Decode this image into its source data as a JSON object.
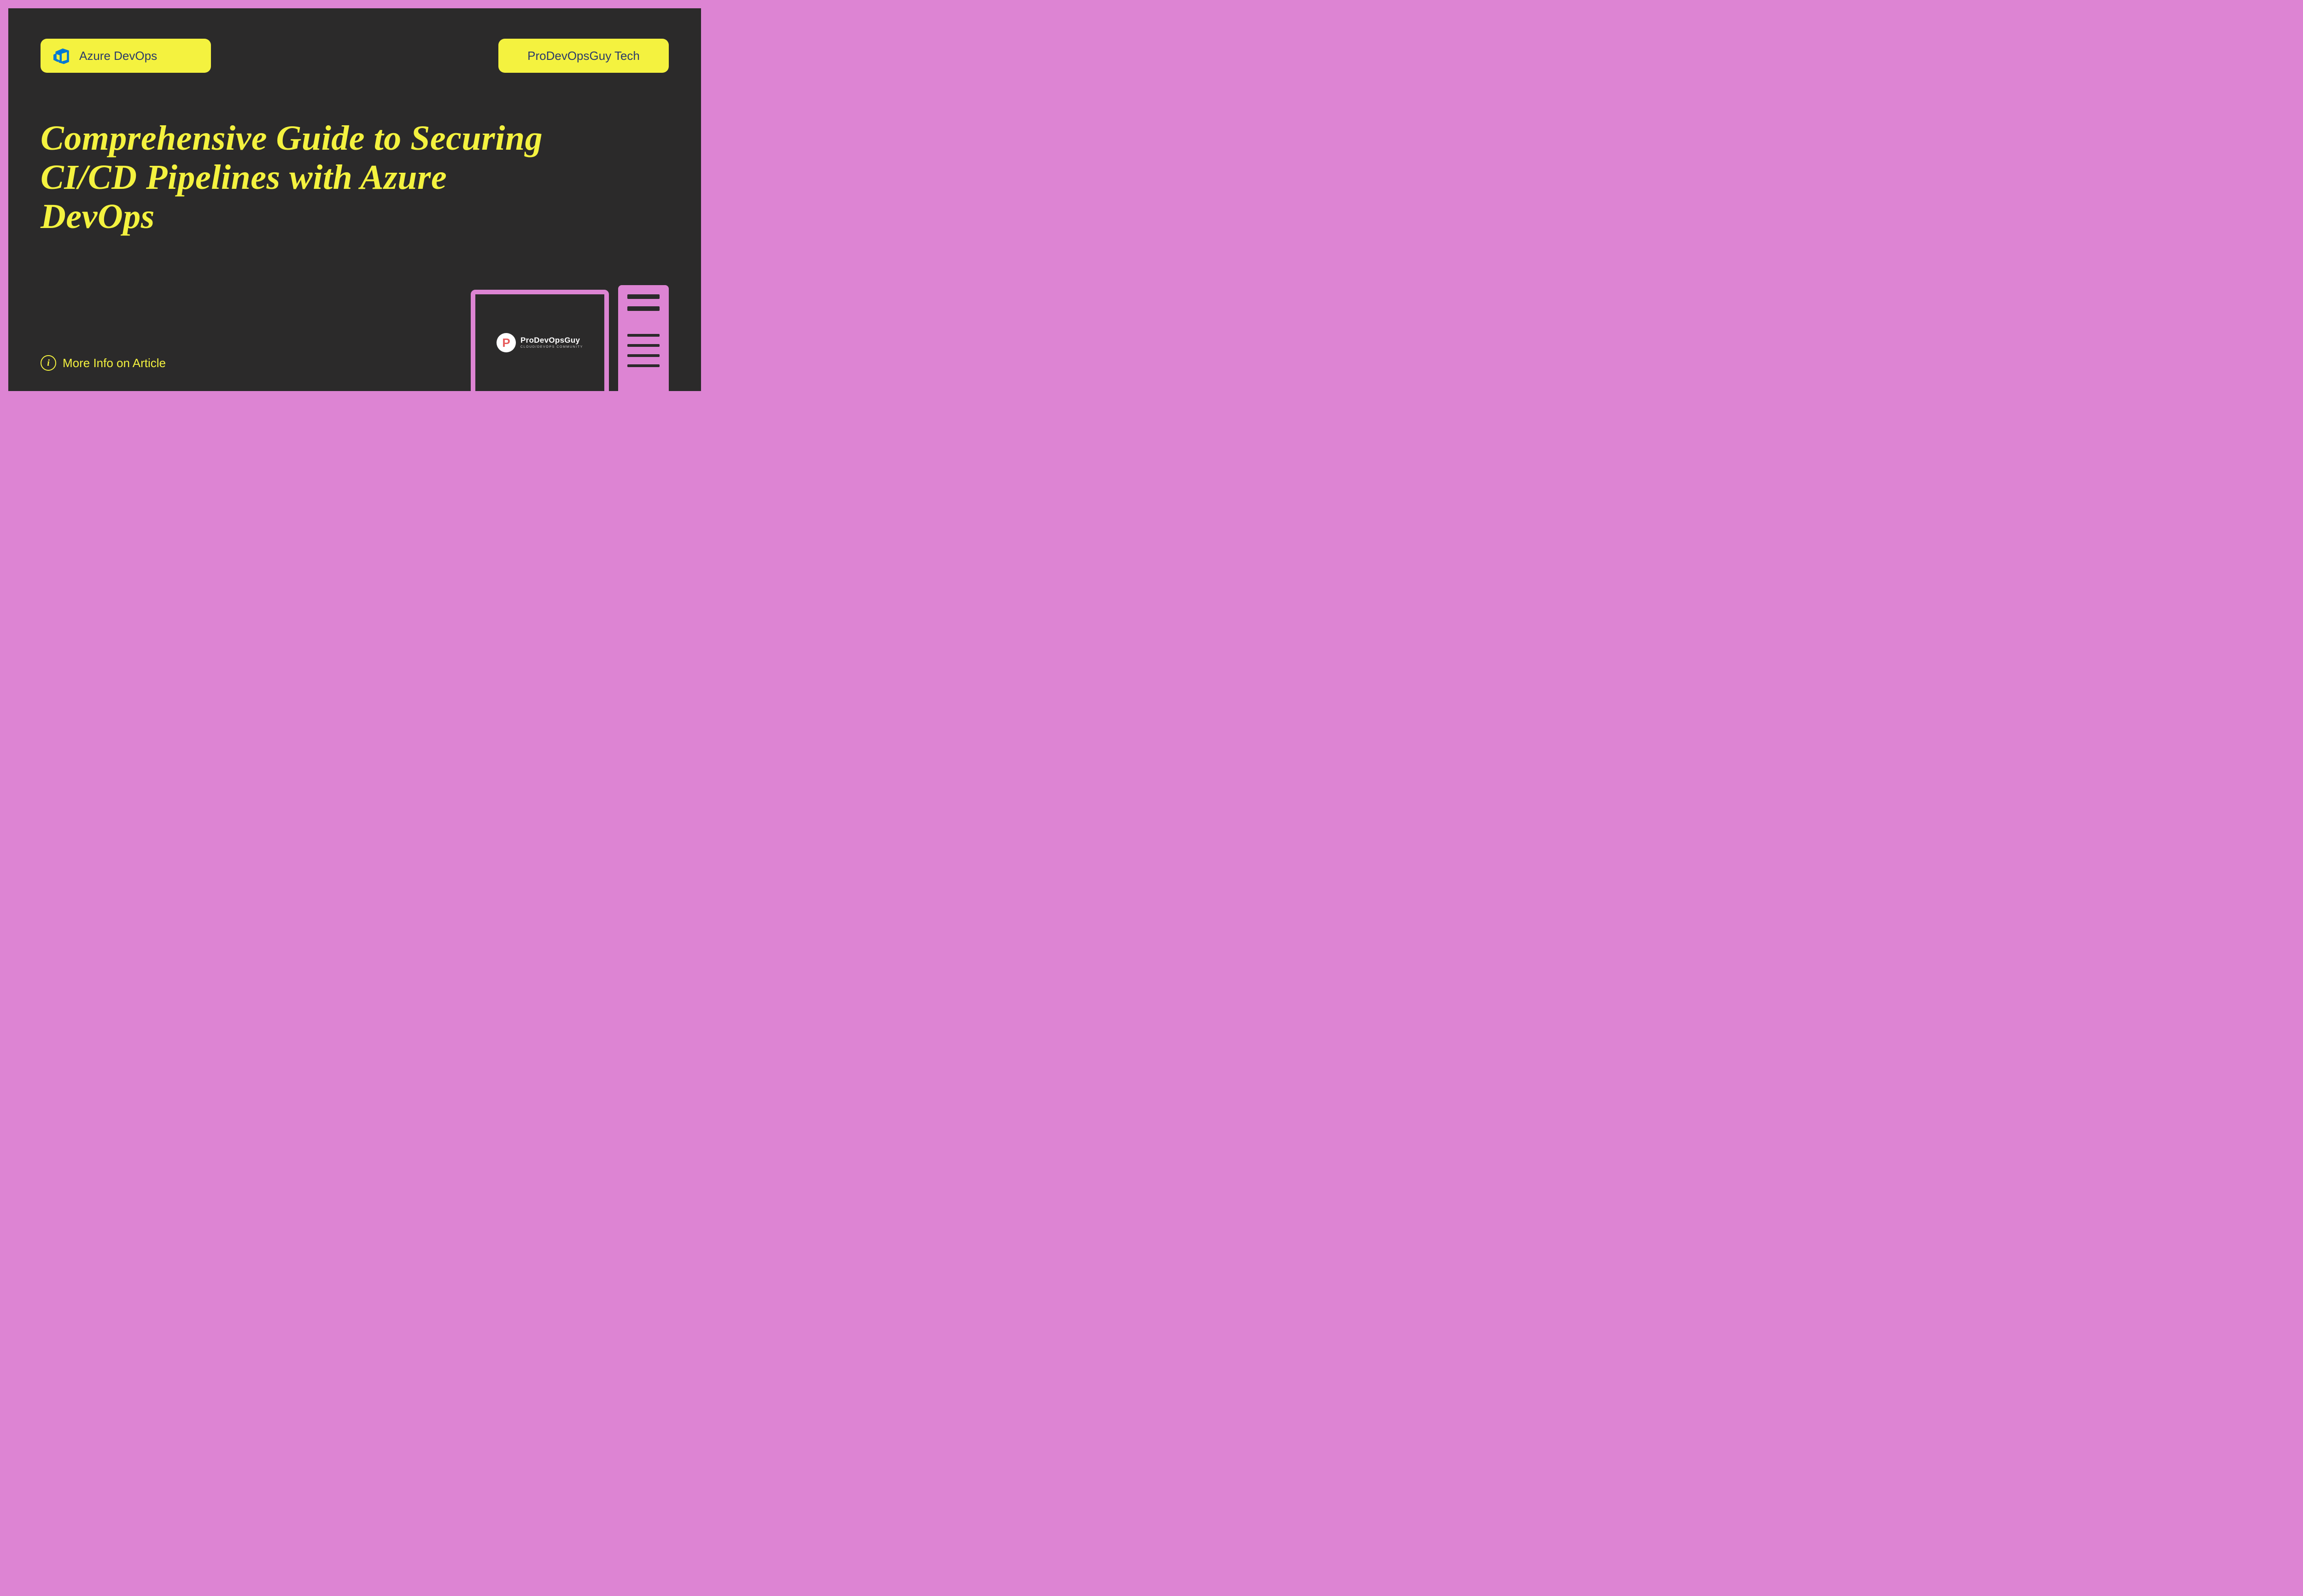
{
  "badges": {
    "left_label": "Azure DevOps",
    "right_label": "ProDevOpsGuy Tech"
  },
  "title": "Comprehensive Guide to Securing CI/CD Pipelines with Azure DevOps",
  "more_info": {
    "text": "More Info on Article",
    "icon_glyph": "i"
  },
  "monitor_logo": {
    "mark": "P",
    "name": "ProDevOpsGuy",
    "tagline": "CLOUD/DEVOPS COMMUNITY"
  },
  "colors": {
    "frame": "#dd84d3",
    "background": "#2b2a2a",
    "accent": "#f4f23f",
    "badge_text": "#2a3a6a"
  }
}
